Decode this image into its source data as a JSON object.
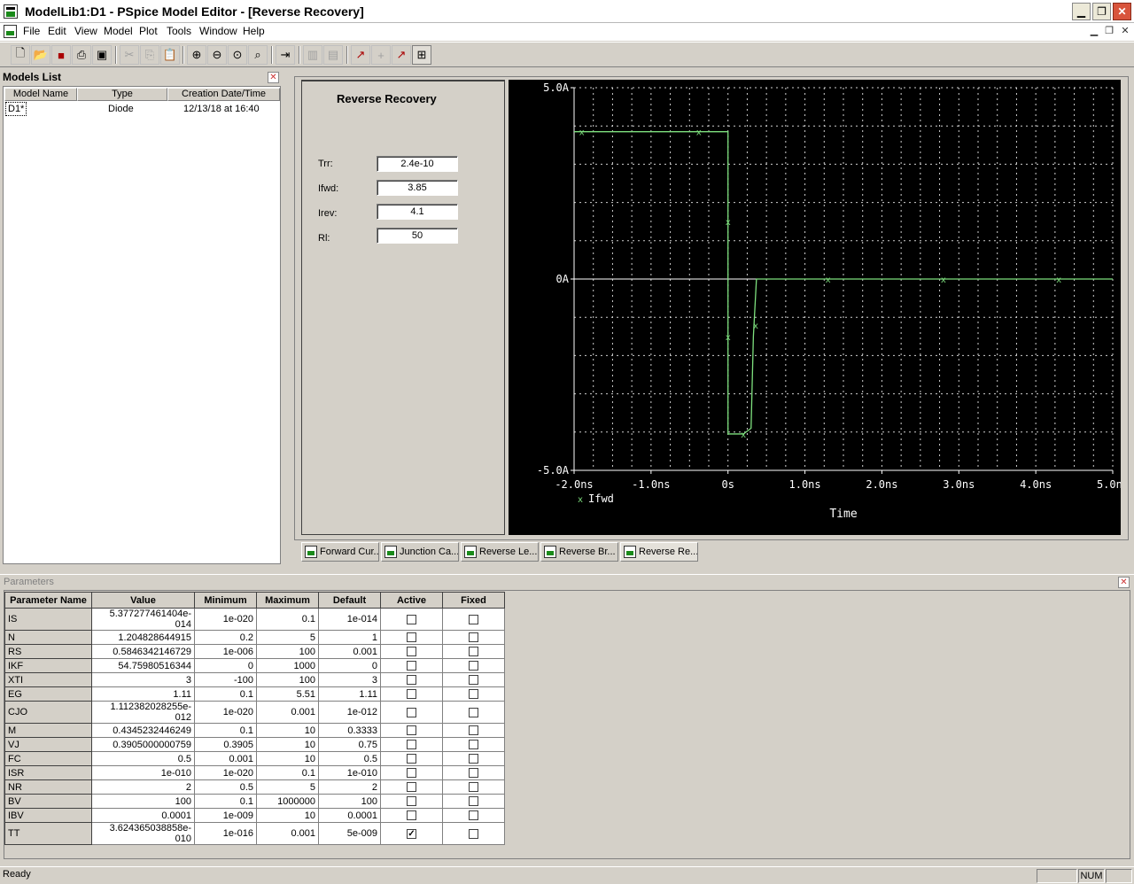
{
  "window": {
    "title": "ModelLib1:D1 - PSpice Model Editor - [Reverse Recovery]"
  },
  "menu": [
    "File",
    "Edit",
    "View",
    "Model",
    "Plot",
    "Tools",
    "Window",
    "Help"
  ],
  "toolbar_icons": [
    "new-icon",
    "open-icon",
    "save-icon",
    "print-icon",
    "print-preview-icon",
    "cut-icon",
    "copy-icon",
    "paste-icon",
    "zoom-in-icon",
    "zoom-out-icon",
    "zoom-area-icon",
    "zoom-fit-icon",
    "mark-icon",
    "split-v-icon",
    "split-h-icon",
    "extract-icon",
    "cross-icon",
    "add-point-icon",
    "fit-icon"
  ],
  "models_list": {
    "title": "Models List",
    "columns": [
      "Model Name",
      "Type",
      "Creation Date/Time"
    ],
    "rows": [
      {
        "name": "D1*",
        "type": "Diode",
        "date": "12/13/18 at 16:40"
      }
    ]
  },
  "reverse_recovery": {
    "title": "Reverse Recovery",
    "fields": [
      {
        "label": "Trr:",
        "value": "2.4e-10"
      },
      {
        "label": "Ifwd:",
        "value": "3.85"
      },
      {
        "label": "Irev:",
        "value": "4.1"
      },
      {
        "label": "Rl:",
        "value": "50"
      }
    ]
  },
  "chart_data": {
    "type": "line",
    "title": "",
    "xlabel": "Time",
    "ylabel": "",
    "xlim": [
      -2.0,
      5.0
    ],
    "ylim": [
      -5.0,
      5.0
    ],
    "x_unit": "ns",
    "y_unit": "A",
    "x_ticks": [
      "-2.0ns",
      "-1.0ns",
      "0s",
      "1.0ns",
      "2.0ns",
      "3.0ns",
      "4.0ns",
      "5.0ns"
    ],
    "y_ticks": [
      "5.0A",
      "0A",
      "-5.0A"
    ],
    "grid": true,
    "legend": "bottom-left",
    "series": [
      {
        "name": "Ifwd",
        "color": "#7ee07e",
        "x": [
          -2.0,
          -0.02,
          0.0,
          0.0,
          0.2,
          0.3,
          0.33,
          0.37,
          5.0
        ],
        "y": [
          3.85,
          3.85,
          3.85,
          -4.05,
          -4.05,
          -3.9,
          -1.5,
          0.0,
          0.0
        ],
        "markers_x": [
          -1.9,
          -0.38,
          0.0,
          0.0,
          0.2,
          0.36,
          1.3,
          2.8,
          4.3
        ],
        "markers_y": [
          3.85,
          3.85,
          1.5,
          -1.5,
          -4.05,
          -1.2,
          0.0,
          0.0,
          0.0
        ]
      }
    ]
  },
  "tabs": [
    "Forward Cur...",
    "Junction Ca...",
    "Reverse Le...",
    "Reverse Br...",
    "Reverse Re..."
  ],
  "parameters": {
    "title": "Parameters",
    "columns": [
      "Parameter Name",
      "Value",
      "Minimum",
      "Maximum",
      "Default",
      "Active",
      "Fixed"
    ],
    "rows": [
      {
        "name": "IS",
        "value": "5.377277461404e-014",
        "min": "1e-020",
        "max": "0.1",
        "def": "1e-014",
        "active": false,
        "fixed": false
      },
      {
        "name": "N",
        "value": "1.204828644915",
        "min": "0.2",
        "max": "5",
        "def": "1",
        "active": false,
        "fixed": false
      },
      {
        "name": "RS",
        "value": "0.5846342146729",
        "min": "1e-006",
        "max": "100",
        "def": "0.001",
        "active": false,
        "fixed": false
      },
      {
        "name": "IKF",
        "value": "54.75980516344",
        "min": "0",
        "max": "1000",
        "def": "0",
        "active": false,
        "fixed": false
      },
      {
        "name": "XTI",
        "value": "3",
        "min": "-100",
        "max": "100",
        "def": "3",
        "active": false,
        "fixed": false
      },
      {
        "name": "EG",
        "value": "1.11",
        "min": "0.1",
        "max": "5.51",
        "def": "1.11",
        "active": false,
        "fixed": false
      },
      {
        "name": "CJO",
        "value": "1.112382028255e-012",
        "min": "1e-020",
        "max": "0.001",
        "def": "1e-012",
        "active": false,
        "fixed": false
      },
      {
        "name": "M",
        "value": "0.4345232446249",
        "min": "0.1",
        "max": "10",
        "def": "0.3333",
        "active": false,
        "fixed": false
      },
      {
        "name": "VJ",
        "value": "0.3905000000759",
        "min": "0.3905",
        "max": "10",
        "def": "0.75",
        "active": false,
        "fixed": false
      },
      {
        "name": "FC",
        "value": "0.5",
        "min": "0.001",
        "max": "10",
        "def": "0.5",
        "active": false,
        "fixed": false
      },
      {
        "name": "ISR",
        "value": "1e-010",
        "min": "1e-020",
        "max": "0.1",
        "def": "1e-010",
        "active": false,
        "fixed": false
      },
      {
        "name": "NR",
        "value": "2",
        "min": "0.5",
        "max": "5",
        "def": "2",
        "active": false,
        "fixed": false
      },
      {
        "name": "BV",
        "value": "100",
        "min": "0.1",
        "max": "1000000",
        "def": "100",
        "active": false,
        "fixed": false
      },
      {
        "name": "IBV",
        "value": "0.0001",
        "min": "1e-009",
        "max": "10",
        "def": "0.0001",
        "active": false,
        "fixed": false
      },
      {
        "name": "TT",
        "value": "3.624365038858e-010",
        "min": "1e-016",
        "max": "0.001",
        "def": "5e-009",
        "active": true,
        "fixed": false
      }
    ]
  },
  "status": {
    "text": "Ready",
    "num": "NUM"
  }
}
